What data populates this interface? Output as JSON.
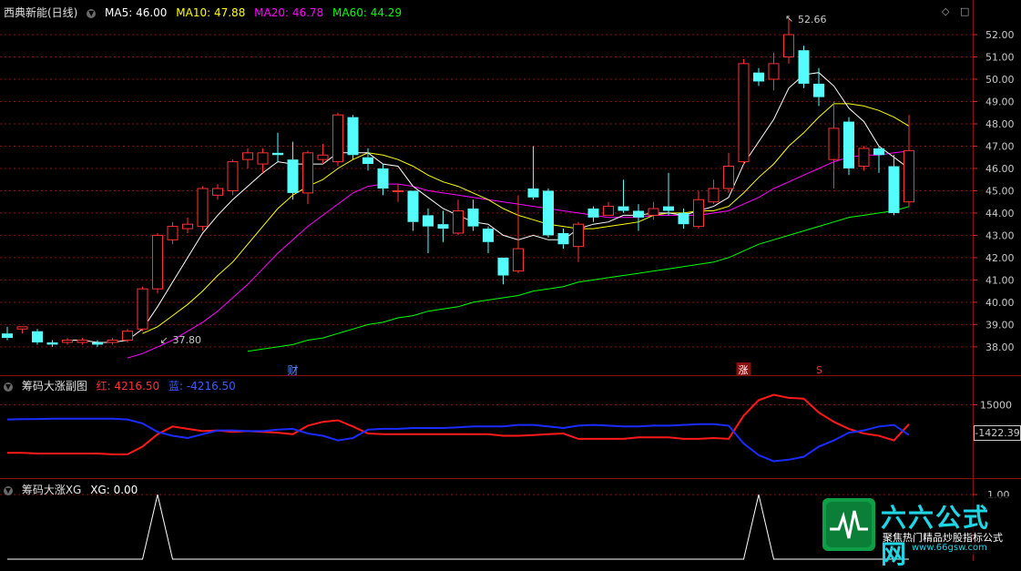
{
  "main_header": {
    "title": "西典新能(日线)",
    "ma5": "MA5: 46.00",
    "ma10": "MA10: 47.88",
    "ma20": "MA20: 46.78",
    "ma60": "MA60: 44.29"
  },
  "sub1_header": {
    "title": "筹码大涨副图",
    "red": "红: 4216.50",
    "blue": "蓝: -4216.50"
  },
  "sub2_header": {
    "title": "筹码大涨XG",
    "xg": "XG: 0.00"
  },
  "markers": {
    "high": "52.66",
    "low": "37.80",
    "cai": "财",
    "zhang": "涨",
    "s": "S"
  },
  "right_readout": "-1422.39",
  "watermark": {
    "title": "六六公式网",
    "slogan": "聚焦热门精品炒股指标公式",
    "url": "www.66gsw.com"
  },
  "colors": {
    "up": "#ff3232",
    "down": "#54fcfc",
    "ma5": "#ffffff",
    "ma10": "#ffff00",
    "ma20": "#ff00ff",
    "ma60": "#00ff00",
    "grid": "#8a0f0f"
  },
  "chart_data": [
    {
      "type": "candlestick",
      "y_ticks": [
        "52.00",
        "51.00",
        "50.00",
        "49.00",
        "48.00",
        "47.00",
        "46.00",
        "45.00",
        "44.00",
        "43.00",
        "42.00",
        "41.00",
        "40.00",
        "39.00",
        "38.00"
      ],
      "ylim": [
        37.3,
        52.9
      ],
      "candles": [
        [
          38.6,
          38.4,
          38.9,
          38.3
        ],
        [
          38.8,
          38.9,
          38.9,
          38.6
        ],
        [
          38.7,
          38.2,
          38.8,
          38.1
        ],
        [
          38.2,
          38.1,
          38.3,
          38.0
        ],
        [
          38.2,
          38.3,
          38.4,
          38.1
        ],
        [
          38.2,
          38.3,
          38.4,
          38.1
        ],
        [
          38.2,
          38.1,
          38.3,
          38.0
        ],
        [
          38.2,
          38.3,
          38.4,
          38.1
        ],
        [
          38.3,
          38.7,
          38.8,
          38.2
        ],
        [
          38.8,
          40.6,
          40.7,
          38.7
        ],
        [
          40.6,
          43.0,
          43.1,
          40.4
        ],
        [
          42.8,
          43.4,
          43.6,
          42.6
        ],
        [
          43.3,
          43.5,
          43.8,
          43.1
        ],
        [
          43.4,
          45.1,
          45.2,
          43.2
        ],
        [
          44.8,
          45.1,
          45.3,
          44.6
        ],
        [
          45.0,
          46.3,
          46.4,
          44.8
        ],
        [
          46.4,
          46.7,
          46.9,
          46.0
        ],
        [
          46.2,
          46.7,
          46.9,
          45.8
        ],
        [
          46.7,
          46.6,
          47.6,
          46.3
        ],
        [
          46.4,
          44.9,
          47.2,
          44.6
        ],
        [
          44.9,
          46.7,
          46.8,
          44.4
        ],
        [
          46.4,
          46.6,
          47.1,
          46.2
        ],
        [
          46.3,
          48.4,
          48.5,
          46.1
        ],
        [
          48.3,
          46.6,
          48.4,
          46.4
        ],
        [
          46.5,
          46.2,
          46.9,
          45.9
        ],
        [
          46.0,
          45.1,
          46.2,
          44.8
        ],
        [
          45.0,
          45.0,
          45.3,
          44.5
        ],
        [
          45.0,
          43.6,
          45.0,
          43.2
        ],
        [
          43.9,
          43.4,
          44.2,
          42.2
        ],
        [
          43.5,
          43.3,
          44.1,
          42.7
        ],
        [
          43.1,
          44.1,
          44.6,
          43.0
        ],
        [
          44.2,
          43.4,
          44.6,
          43.2
        ],
        [
          43.3,
          42.7,
          43.4,
          42.2
        ],
        [
          42.0,
          41.2,
          42.0,
          40.8
        ],
        [
          41.4,
          42.4,
          44.8,
          41.3
        ],
        [
          45.1,
          44.7,
          47.0,
          44.6
        ],
        [
          45.0,
          43.0,
          45.1,
          42.9
        ],
        [
          43.1,
          42.6,
          43.3,
          42.4
        ],
        [
          42.5,
          43.5,
          43.6,
          41.8
        ],
        [
          44.2,
          43.8,
          44.3,
          43.6
        ],
        [
          43.9,
          44.3,
          44.5,
          43.9
        ],
        [
          44.3,
          44.1,
          45.5,
          44.0
        ],
        [
          44.1,
          43.8,
          44.4,
          43.2
        ],
        [
          43.9,
          44.2,
          44.5,
          43.7
        ],
        [
          44.3,
          44.1,
          45.8,
          43.9
        ],
        [
          44.0,
          43.5,
          44.2,
          43.3
        ],
        [
          43.4,
          44.6,
          45.0,
          43.3
        ],
        [
          44.5,
          45.1,
          45.5,
          44.4
        ],
        [
          45.1,
          46.1,
          46.7,
          44.9
        ],
        [
          46.3,
          50.7,
          50.9,
          46.2
        ],
        [
          50.3,
          49.9,
          50.5,
          49.7
        ],
        [
          50.0,
          50.7,
          51.2,
          49.5
        ],
        [
          51.0,
          52.0,
          52.7,
          50.7
        ],
        [
          51.3,
          49.8,
          51.5,
          49.6
        ],
        [
          49.8,
          49.2,
          50.5,
          48.8
        ],
        [
          46.4,
          47.8,
          49.0,
          45.1
        ],
        [
          48.1,
          46.0,
          48.3,
          45.7
        ],
        [
          46.1,
          46.9,
          47.0,
          45.9
        ],
        [
          46.9,
          46.6,
          47.0,
          45.8
        ],
        [
          46.1,
          44.0,
          46.6,
          43.9
        ],
        [
          44.5,
          46.8,
          48.4,
          44.3
        ]
      ],
      "ma5": [
        null,
        null,
        null,
        null,
        38.3,
        38.3,
        38.2,
        38.2,
        38.3,
        38.8,
        39.8,
        40.9,
        42.0,
        43.1,
        43.9,
        44.6,
        45.2,
        45.8,
        46.3,
        46.2,
        46.2,
        46.2,
        46.7,
        46.7,
        46.7,
        46.2,
        46.1,
        45.2,
        44.7,
        44.2,
        43.9,
        43.6,
        43.5,
        43.0,
        42.8,
        43.0,
        42.8,
        42.8,
        43.3,
        43.5,
        43.6,
        43.9,
        43.9,
        44.0,
        44.0,
        43.9,
        44.1,
        44.3,
        44.7,
        46.2,
        47.2,
        48.2,
        49.6,
        50.2,
        50.3,
        49.7,
        48.7,
        48.1,
        47.0,
        46.5,
        46.0
      ],
      "ma10": [
        null,
        null,
        null,
        null,
        null,
        null,
        null,
        null,
        null,
        38.6,
        38.9,
        39.4,
        39.9,
        40.5,
        41.2,
        41.8,
        42.6,
        43.4,
        44.2,
        44.8,
        45.2,
        45.5,
        46.0,
        46.4,
        46.7,
        46.6,
        46.4,
        46.1,
        45.7,
        45.4,
        45.2,
        44.9,
        44.6,
        44.2,
        43.9,
        43.7,
        43.5,
        43.4,
        43.3,
        43.3,
        43.4,
        43.5,
        43.6,
        43.9,
        44.0,
        44.0,
        44.1,
        44.1,
        44.3,
        44.9,
        45.6,
        46.2,
        47.0,
        47.6,
        48.3,
        48.9,
        48.9,
        48.8,
        48.6,
        48.3,
        47.9
      ],
      "ma20": [
        null,
        null,
        null,
        null,
        null,
        null,
        null,
        null,
        37.5,
        37.7,
        38.0,
        38.3,
        38.7,
        39.1,
        39.6,
        40.2,
        40.8,
        41.5,
        42.2,
        42.8,
        43.4,
        43.9,
        44.4,
        44.9,
        45.2,
        45.3,
        45.3,
        45.2,
        45.0,
        44.9,
        44.8,
        44.7,
        44.6,
        44.5,
        44.4,
        44.3,
        44.2,
        44.1,
        44.0,
        43.9,
        43.8,
        43.8,
        43.8,
        43.9,
        43.9,
        43.9,
        43.9,
        44.0,
        44.1,
        44.4,
        44.7,
        45.1,
        45.4,
        45.7,
        46.0,
        46.3,
        46.5,
        46.6,
        46.6,
        46.7,
        46.78
      ],
      "ma60": [
        null,
        null,
        null,
        null,
        null,
        null,
        null,
        null,
        null,
        null,
        null,
        null,
        null,
        null,
        null,
        null,
        37.8,
        37.9,
        38.0,
        38.1,
        38.3,
        38.4,
        38.6,
        38.8,
        39.0,
        39.1,
        39.3,
        39.4,
        39.6,
        39.7,
        39.8,
        40.0,
        40.1,
        40.2,
        40.3,
        40.5,
        40.6,
        40.7,
        40.9,
        41.0,
        41.1,
        41.2,
        41.3,
        41.4,
        41.5,
        41.6,
        41.7,
        41.8,
        42.0,
        42.3,
        42.6,
        42.8,
        43.0,
        43.2,
        43.4,
        43.6,
        43.8,
        43.9,
        44.0,
        44.1,
        44.29
      ]
    },
    {
      "type": "line",
      "y_ticks": [
        "15000"
      ],
      "ylim": [
        -30000,
        30000
      ],
      "series": [
        {
          "name": "红",
          "values": [
            -16000,
            -16000,
            -16500,
            -16500,
            -16500,
            -16500,
            -16500,
            -17000,
            -17000,
            -12000,
            -4000,
            1000,
            -500,
            -2000,
            -1500,
            -2500,
            -2000,
            -2500,
            -3000,
            -4000,
            1500,
            4000,
            5000,
            1000,
            -3500,
            -4000,
            -4000,
            -4000,
            -4000,
            -4000,
            -4000,
            -4000,
            -4000,
            -5000,
            -5000,
            -4500,
            -4000,
            -3500,
            -7000,
            -7000,
            -7000,
            -7000,
            -6000,
            -6000,
            -6000,
            -7000,
            -7000,
            -6500,
            -7000,
            8000,
            18000,
            21500,
            19500,
            19000,
            10000,
            4000,
            -500,
            -3500,
            -5000,
            -8000,
            2500
          ]
        },
        {
          "name": "蓝",
          "values": [
            5500,
            5700,
            5800,
            6000,
            6000,
            6000,
            6000,
            6000,
            5500,
            3000,
            -2500,
            -5000,
            -6500,
            -4000,
            -1500,
            -1500,
            -2000,
            -2000,
            -1000,
            -500,
            -3500,
            -5000,
            -8000,
            -6500,
            -1000,
            -500,
            -500,
            0,
            0,
            0,
            500,
            1000,
            1000,
            1000,
            2000,
            2000,
            1000,
            0,
            1500,
            2000,
            1500,
            1000,
            1000,
            1500,
            1500,
            2000,
            2500,
            2500,
            1500,
            -10000,
            -17500,
            -21500,
            -20500,
            -18500,
            -12000,
            -8000,
            -3000,
            -1500,
            1000,
            2000,
            -4500
          ]
        }
      ]
    },
    {
      "type": "line",
      "y_ticks": [
        "1.00"
      ],
      "ylim": [
        0,
        1.1
      ],
      "series": [
        {
          "name": "XG",
          "values": [
            0,
            0,
            0,
            0,
            0,
            0,
            0,
            0,
            0,
            0,
            1,
            0,
            0,
            0,
            0,
            0,
            0,
            0,
            0,
            0,
            0,
            0,
            0,
            0,
            0,
            0,
            0,
            0,
            0,
            0,
            0,
            0,
            0,
            0,
            0,
            0,
            0,
            0,
            0,
            0,
            0,
            0,
            0,
            0,
            0,
            0,
            0,
            0,
            0,
            0,
            1,
            0,
            0,
            0,
            0,
            0,
            0,
            0,
            0,
            0,
            0
          ]
        }
      ]
    }
  ]
}
